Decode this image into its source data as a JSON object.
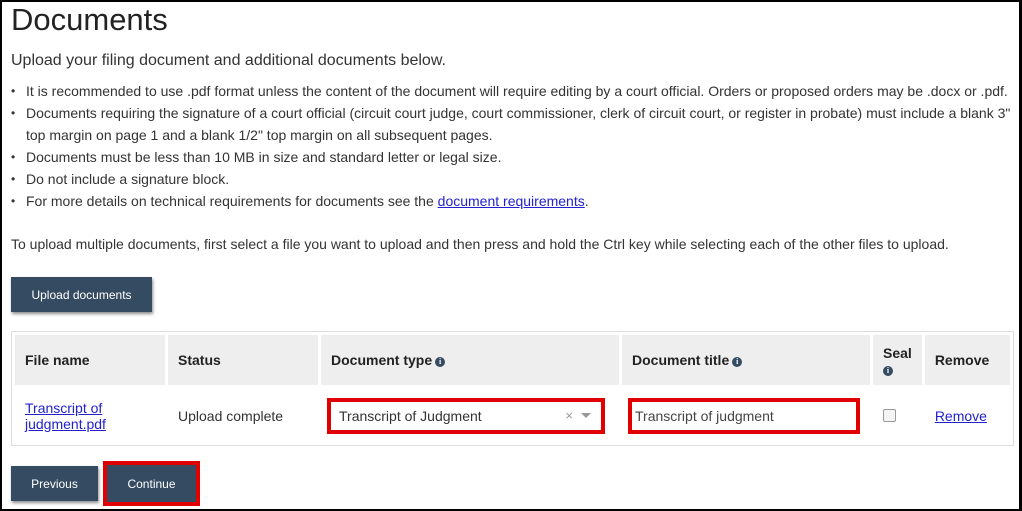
{
  "page": {
    "title": "Documents",
    "intro": "Upload your filing document and additional documents below.",
    "requirements": [
      {
        "text": "It is recommended to use .pdf format unless the content of the document will require editing by a court official. Orders or proposed orders may be .docx or .pdf."
      },
      {
        "text": "Documents requiring the signature of a court official (circuit court judge, court commissioner, clerk of circuit court, or register in probate) must include a blank 3\" top margin on page 1 and a blank 1/2\" top margin on all subsequent pages."
      },
      {
        "text": "Documents must be less than 10 MB in size and standard letter or legal size."
      },
      {
        "text": "Do not include a signature block."
      },
      {
        "text_before": "For more details on technical requirements for documents see the ",
        "link": "document requirements",
        "text_after": "."
      }
    ],
    "multi_upload_note": "To upload multiple documents, first select a file you want to upload and then press and hold the Ctrl key while selecting each of the other files to upload."
  },
  "buttons": {
    "upload": "Upload documents",
    "previous": "Previous",
    "continue": "Continue"
  },
  "table": {
    "headers": {
      "file_name": "File name",
      "status": "Status",
      "document_type": "Document type",
      "document_title": "Document title",
      "seal": "Seal",
      "remove": "Remove"
    },
    "rows": [
      {
        "file_name": "Transcript of judgment.pdf",
        "status": "Upload complete",
        "document_type": "Transcript of Judgment",
        "document_title": "Transcript of judgment",
        "sealed": false,
        "remove_label": "Remove"
      }
    ]
  },
  "icons": {
    "info": "i",
    "clear": "×"
  },
  "colors": {
    "button_bg": "#344b61",
    "highlight": "#e00000",
    "link": "#2222cc",
    "header_bg": "#eeeeee"
  }
}
